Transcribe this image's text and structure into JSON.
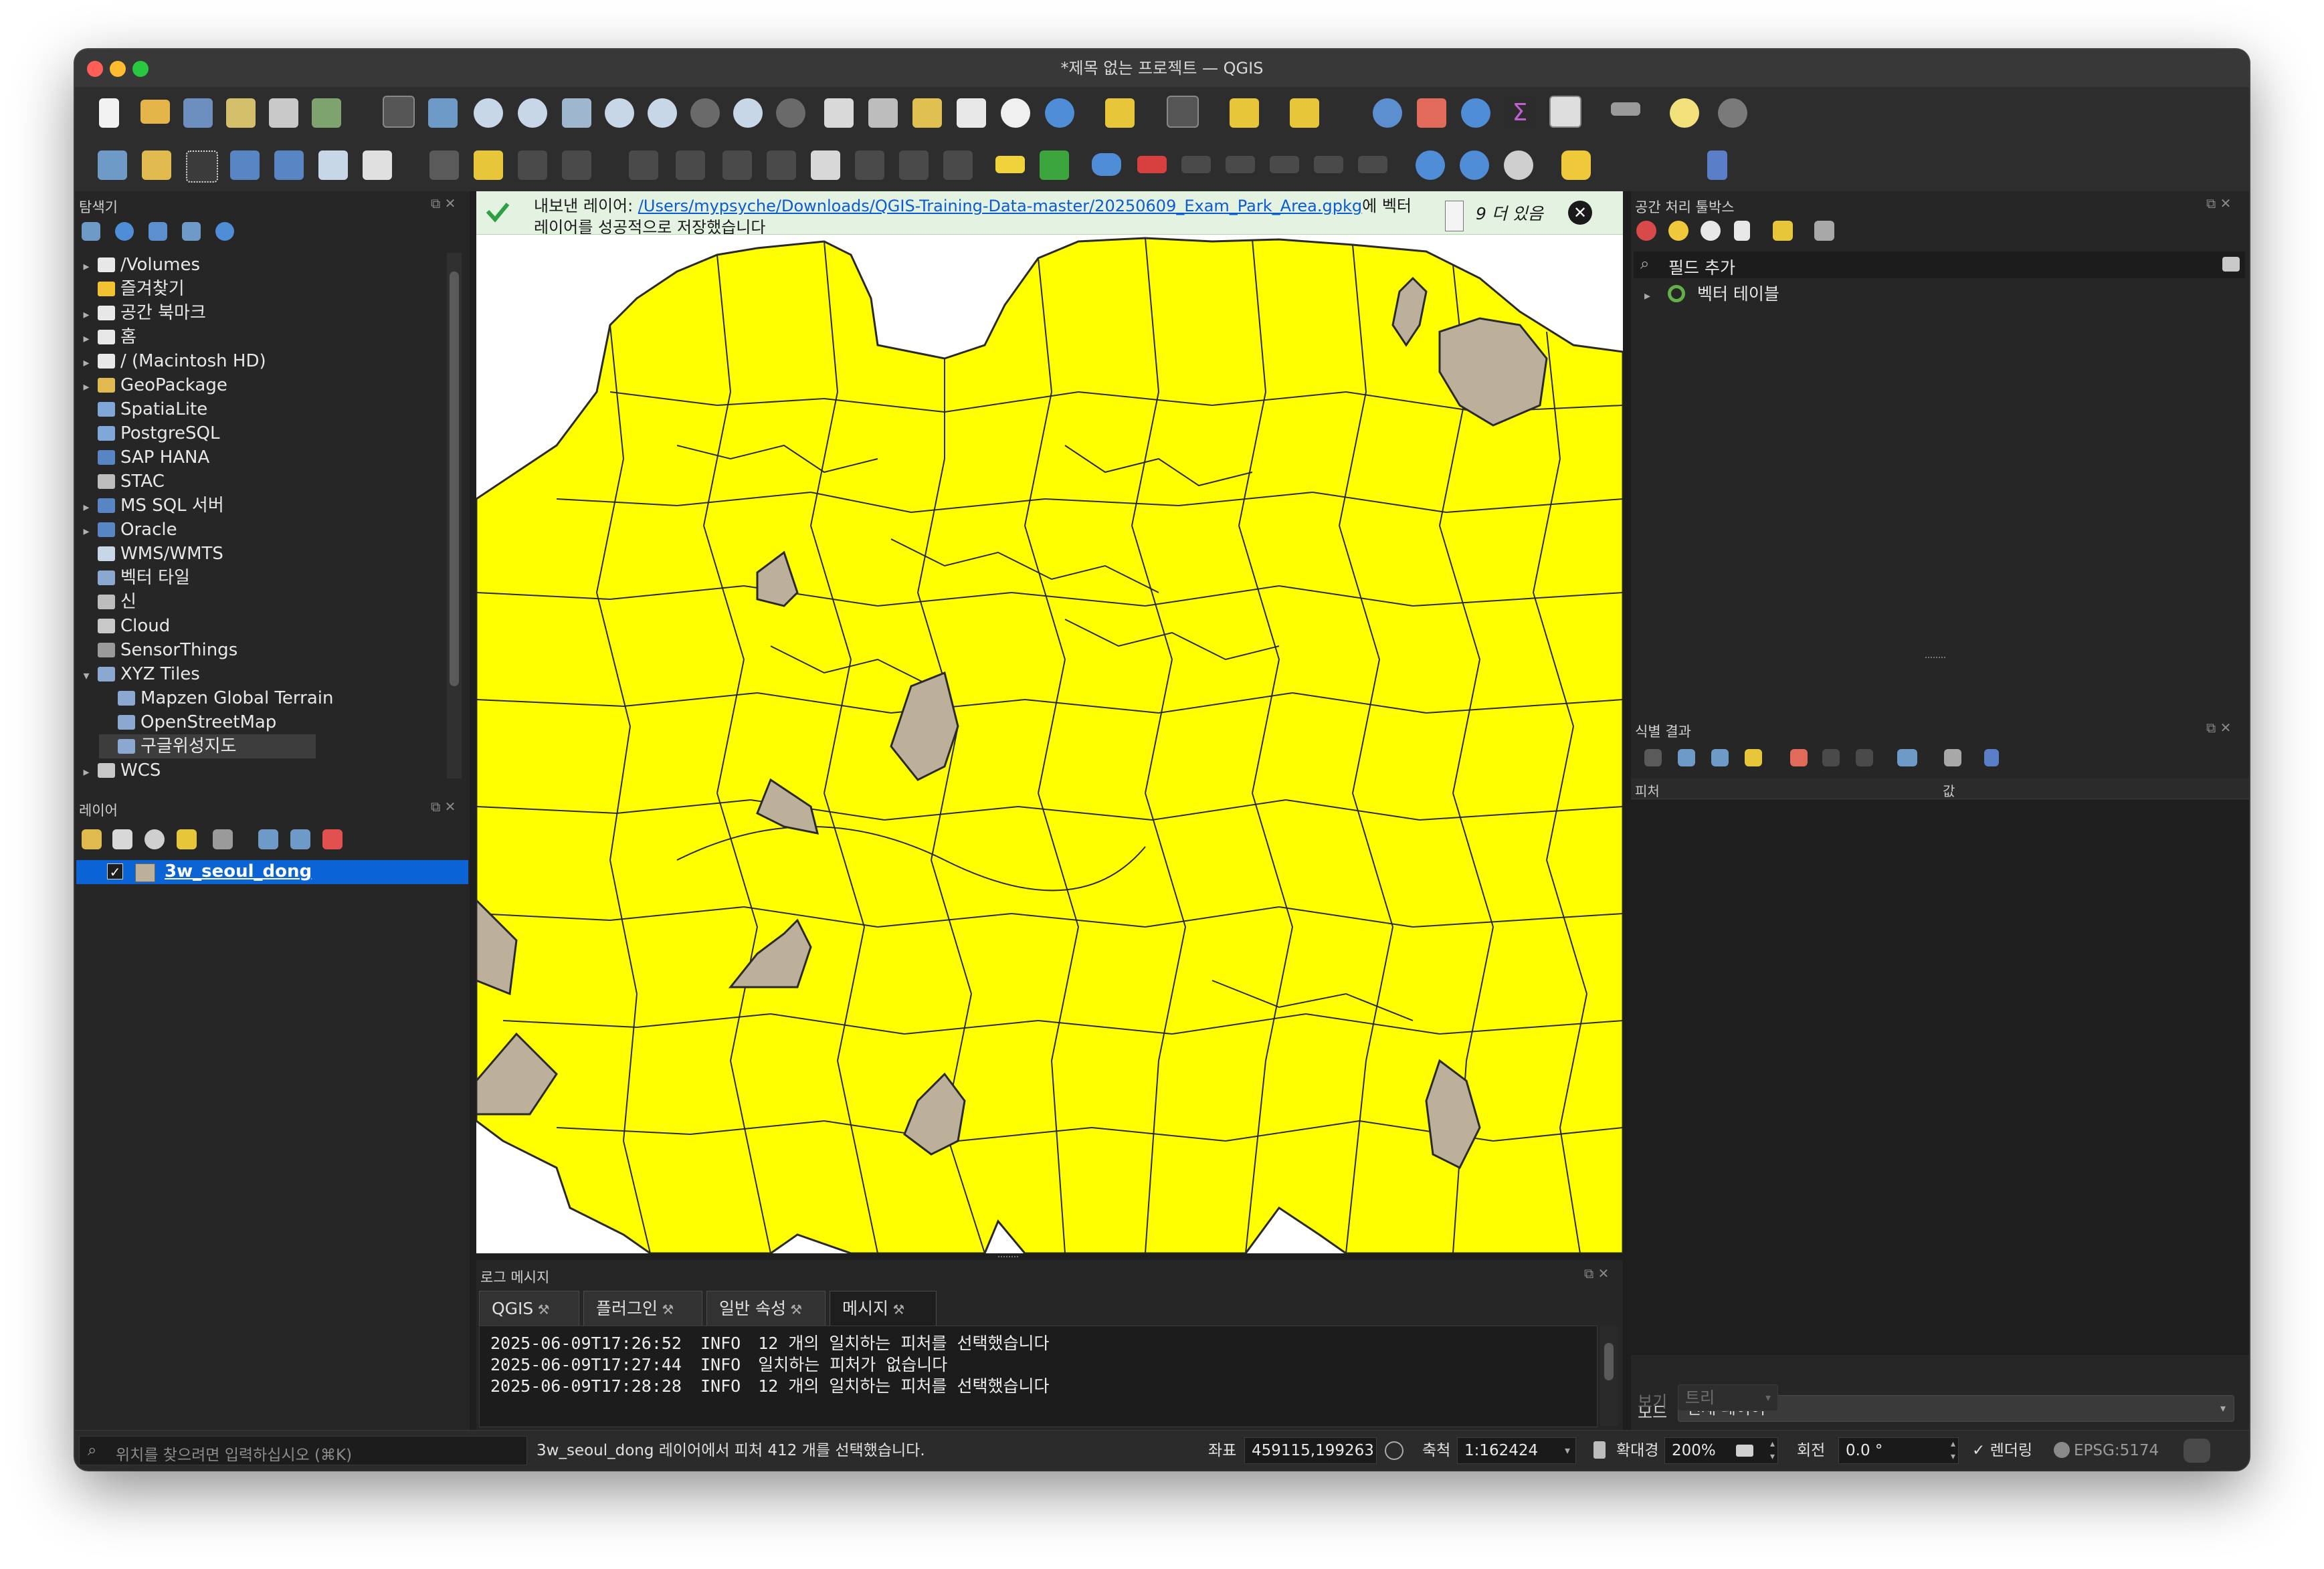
{
  "window": {
    "title": "*제목 없는 프로젝트 — QGIS"
  },
  "browser": {
    "title": "탐색기",
    "items": [
      {
        "label": "/Volumes",
        "icon": "folder-icon",
        "expand": "▸"
      },
      {
        "label": "즐겨찾기",
        "icon": "star-icon",
        "expand": ""
      },
      {
        "label": "공간 북마크",
        "icon": "bookmark-icon",
        "expand": "▸"
      },
      {
        "label": "홈",
        "icon": "home-icon",
        "expand": "▸"
      },
      {
        "label": "/ (Macintosh HD)",
        "icon": "folder-icon",
        "expand": "▸"
      },
      {
        "label": "GeoPackage",
        "icon": "geopackage-icon",
        "expand": "▸"
      },
      {
        "label": "SpatiaLite",
        "icon": "spatialite-icon",
        "expand": ""
      },
      {
        "label": "PostgreSQL",
        "icon": "postgresql-icon",
        "expand": ""
      },
      {
        "label": "SAP HANA",
        "icon": "sap-hana-icon",
        "expand": ""
      },
      {
        "label": "STAC",
        "icon": "stac-icon",
        "expand": ""
      },
      {
        "label": "MS SQL 서버",
        "icon": "mssql-icon",
        "expand": "▸"
      },
      {
        "label": "Oracle",
        "icon": "oracle-icon",
        "expand": "▸"
      },
      {
        "label": "WMS/WMTS",
        "icon": "wms-icon",
        "expand": ""
      },
      {
        "label": "벡터 타일",
        "icon": "vector-tile-icon",
        "expand": ""
      },
      {
        "label": "신",
        "icon": "scene-icon",
        "expand": ""
      },
      {
        "label": "Cloud",
        "icon": "cloud-icon",
        "expand": ""
      },
      {
        "label": "SensorThings",
        "icon": "sensorthings-icon",
        "expand": ""
      },
      {
        "label": "XYZ Tiles",
        "icon": "xyz-tiles-icon",
        "expand": "▾"
      },
      {
        "label": "Mapzen Global Terrain",
        "icon": "tile-icon",
        "expand": "",
        "child": true
      },
      {
        "label": "OpenStreetMap",
        "icon": "tile-icon",
        "expand": "",
        "child": true
      },
      {
        "label": "구글위성지도",
        "icon": "tile-icon",
        "expand": "",
        "child": true,
        "selected": true
      },
      {
        "label": "WCS",
        "icon": "wcs-icon",
        "expand": "▸"
      }
    ]
  },
  "layers": {
    "title": "레이어",
    "items": [
      {
        "label": "3w_seoul_dong",
        "checked": "✓",
        "swatch": "#bdb09b"
      }
    ]
  },
  "message_bar": {
    "prefix": "내보낸 레이어: ",
    "path": "/Users/mypsyche/Downloads/QGIS-Training-Data-master/20250609_Exam_Park_Area.gpkg",
    "suffix": "에 벡터",
    "line2": "레이어를 성공적으로 저장했습니다",
    "more": "9 더 있음"
  },
  "processing": {
    "title": "공간 처리 툴박스",
    "search_value": "필드 추가",
    "tree_item": "벡터 테이블"
  },
  "identify": {
    "title": "식별 결과",
    "col_feature": "피처",
    "col_value": "값",
    "mode_label": "모드",
    "mode_value": "현재 레이어",
    "view_label": "보기",
    "view_value": "트리"
  },
  "log": {
    "title": "로그 메시지",
    "tabs": [
      "QGIS",
      "플러그인",
      "일반 속성",
      "메시지"
    ],
    "active_tab": 3,
    "lines": [
      {
        "time": "2025-06-09T17:26:52",
        "level": "INFO",
        "text": "12 개의 일치하는 피처를 선택했습니다"
      },
      {
        "time": "2025-06-09T17:27:44",
        "level": "INFO",
        "text": "일치하는 피처가 없습니다"
      },
      {
        "time": "2025-06-09T17:28:28",
        "level": "INFO",
        "text": "12 개의 일치하는 피처를 선택했습니다"
      }
    ]
  },
  "statusbar": {
    "locator_placeholder": "위치를 찾으려면 입력하십시오 (⌘K)",
    "message": "3w_seoul_dong 레이어에서 피처 412 개를 선택했습니다.",
    "coord_label": "좌표",
    "coord_value": "459115,199263",
    "scale_label": "축척",
    "scale_value": "1:162424",
    "magnifier_label": "확대경",
    "magnifier_value": "200%",
    "rotation_label": "회전",
    "rotation_value": "0.0 °",
    "render_label": "렌더링",
    "render_checked": "✓",
    "crs": "EPSG:5174"
  },
  "map": {
    "fill": "#ffff00",
    "park": "#bdb09b",
    "stroke": "#2a2a2a"
  },
  "colors": {
    "accent": "#0a64d6",
    "success": "#2ea043"
  }
}
